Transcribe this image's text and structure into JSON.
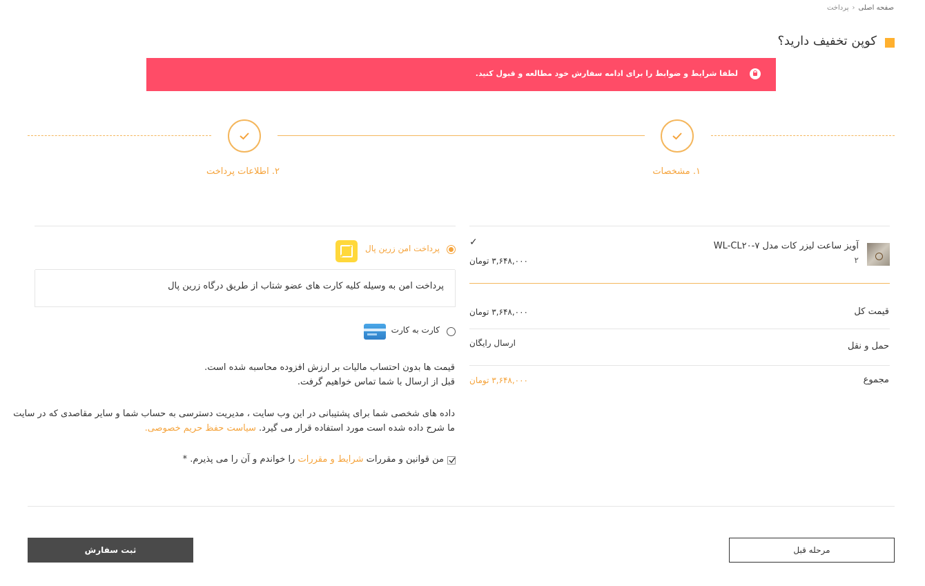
{
  "breadcrumb": {
    "home": "صفحه اصلی",
    "separator": "‹",
    "current": "پرداخت"
  },
  "coupon": {
    "title": "کوپن تخفیف دارید؟"
  },
  "alert": {
    "text": "لطفا شرایط و ضوابط را برای ادامه سفارش خود مطالعه و قبول کنید.",
    "icon": "lock-icon"
  },
  "steps": [
    {
      "label": "۱. مشخصات",
      "done": true
    },
    {
      "label": "۲. اطلاعات پرداخت",
      "done": true
    }
  ],
  "order": {
    "product": {
      "name": "آویز ساعت لیزر کات مدل WL-CL۲۰-۷",
      "quantity": "۲",
      "price": "۳,۶۴۸,۰۰۰ تومان",
      "selected_mark": "✓"
    },
    "subtotal": {
      "label": "قیمت کل",
      "value": "۳,۶۴۸,۰۰۰ تومان"
    },
    "shipping": {
      "label": "حمل و نقل",
      "value": "ارسال رایگان"
    },
    "total": {
      "label": "مجموع",
      "value": "۳,۶۴۸,۰۰۰ تومان"
    }
  },
  "payment": {
    "gateways": [
      {
        "label": "پرداخت امن زرین پال",
        "selected": true,
        "description": "پرداخت امن به وسیله کلیه کارت های عضو شتاب از طریق درگاه زرین پال"
      },
      {
        "label": "کارت به کارت",
        "selected": false
      }
    ]
  },
  "notes": {
    "tax_line1": "قیمت ها بدون احتساب مالیات بر ارزش افزوده محاسبه شده است.",
    "tax_line2": "قبل از ارسال با شما تماس خواهیم گرفت.",
    "privacy_line1": "داده های شخصی شما برای پشتیبانی در این وب سایت ، مدیریت دسترسی به حساب شما و سایر مقاصدی که در سایت",
    "privacy_line2": "ما شرح داده شده است مورد استفاده قرار می گیرد.",
    "privacy_link": "سیاست حفظ حریم خصوصی."
  },
  "terms": {
    "checked": true,
    "prefix": "من قوانین و مقررات",
    "link": "شرایط و مقررات",
    "suffix": "را خواندم و آن را می پذیرم.",
    "required_mark": "*"
  },
  "buttons": {
    "submit": "ثبت سفارش",
    "previous": "مرحله قبل"
  },
  "colors": {
    "accent": "#f5a33b",
    "alert": "#ff4c67",
    "coupon_square": "#ffb02e",
    "submit_bg": "#4a4a4a"
  }
}
